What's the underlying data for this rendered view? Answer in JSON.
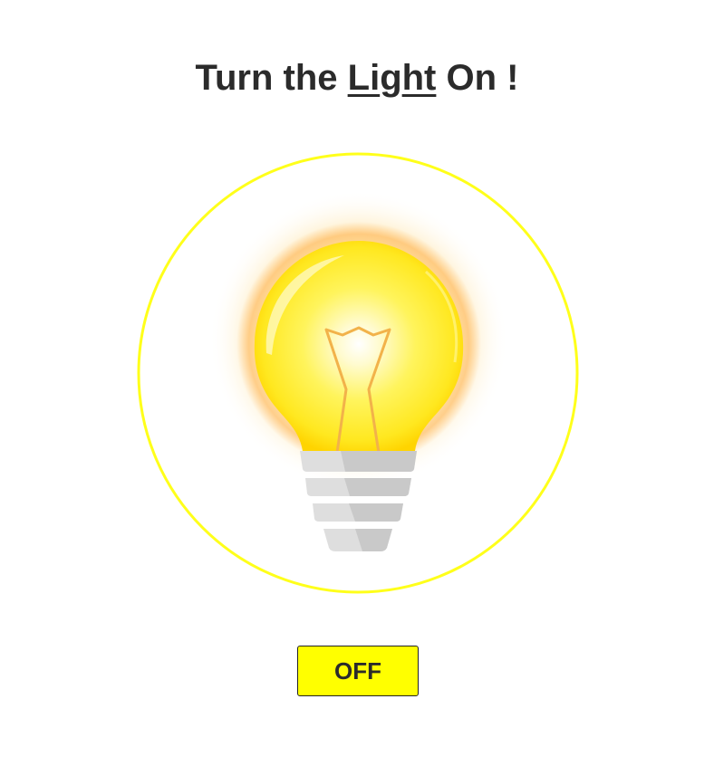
{
  "heading": {
    "prefix": "Turn the ",
    "highlight_part1": "Li",
    "highlight_gap": "g",
    "highlight_part2": "ht",
    "suffix": " On !"
  },
  "bulb": {
    "state": "on",
    "ring_color": "#ffff1a",
    "glass_color": "#ffee33",
    "glow_color": "#ff8a00",
    "filament_color": "#f2b24a",
    "base_color": "#dcdcdc"
  },
  "toggle_button": {
    "label": "OFF",
    "background": "#ffff00"
  },
  "icons": [
    "lightbulb-icon"
  ]
}
